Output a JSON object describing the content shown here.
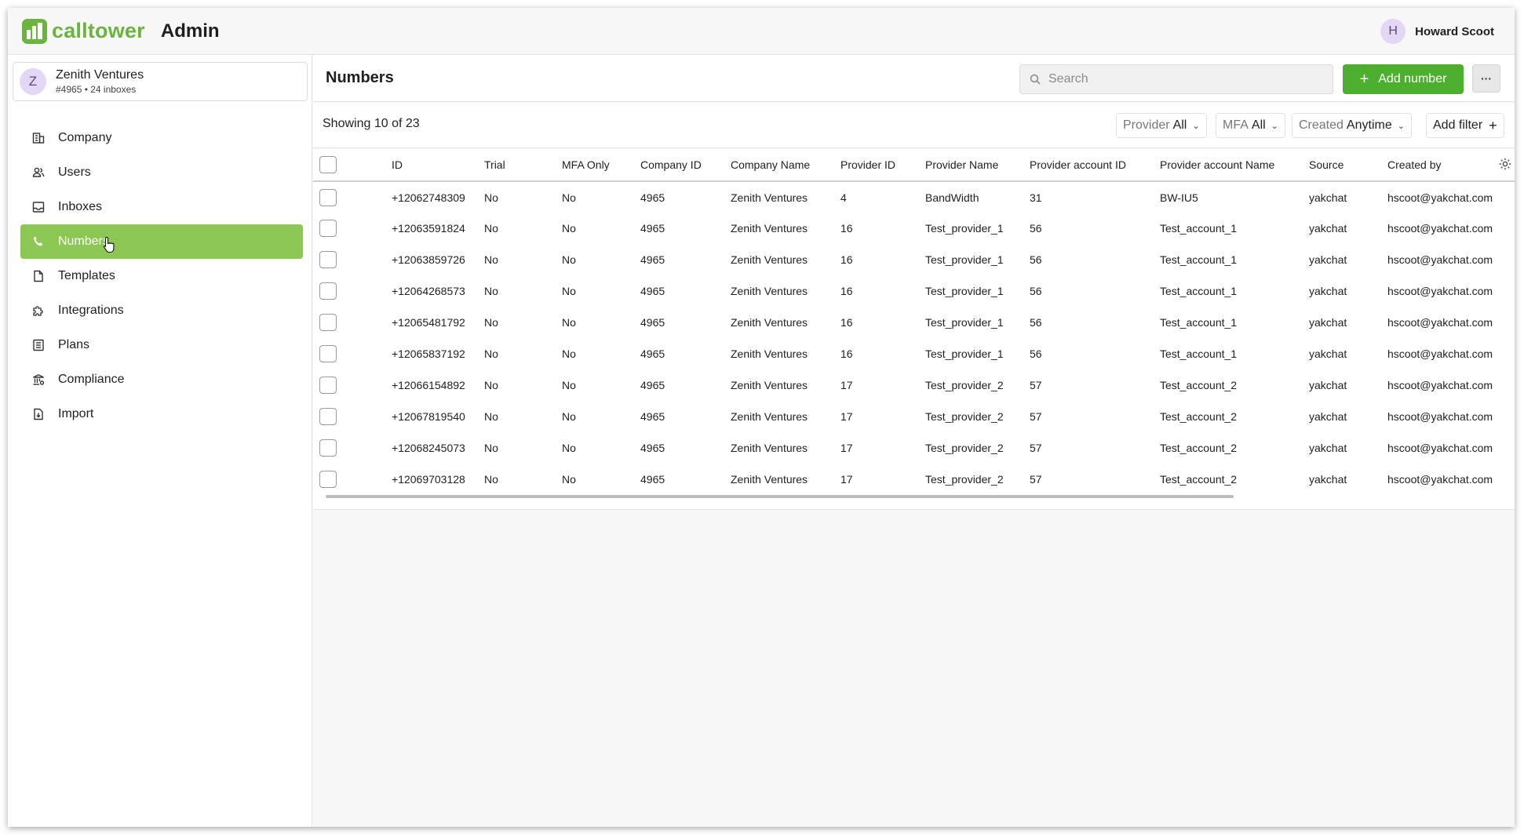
{
  "header": {
    "brand": "calltower",
    "app_title": "Admin",
    "user": {
      "initial": "H",
      "name": "Howard Scoot"
    }
  },
  "org": {
    "initial": "Z",
    "name": "Zenith Ventures",
    "subtitle": "#4965 • 24 inboxes"
  },
  "sidebar": {
    "items": [
      {
        "label": "Company",
        "icon": "building-icon"
      },
      {
        "label": "Users",
        "icon": "users-icon"
      },
      {
        "label": "Inboxes",
        "icon": "inbox-icon"
      },
      {
        "label": "Numbers",
        "icon": "phone-icon",
        "active": true
      },
      {
        "label": "Templates",
        "icon": "file-icon"
      },
      {
        "label": "Integrations",
        "icon": "puzzle-icon"
      },
      {
        "label": "Plans",
        "icon": "list-icon"
      },
      {
        "label": "Compliance",
        "icon": "bank-icon"
      },
      {
        "label": "Import",
        "icon": "file-import-icon"
      }
    ]
  },
  "main": {
    "title": "Numbers",
    "search_placeholder": "Search",
    "add_button": "Add number",
    "more_button": "···",
    "showing": "Showing 10 of 23",
    "filters": [
      {
        "label": "Provider",
        "value": "All"
      },
      {
        "label": "MFA",
        "value": "All"
      },
      {
        "label": "Created",
        "value": "Anytime"
      }
    ],
    "add_filter": "Add filter"
  },
  "table": {
    "columns": [
      "ID",
      "Trial",
      "MFA Only",
      "Company ID",
      "Company Name",
      "Provider ID",
      "Provider Name",
      "Provider account ID",
      "Provider account Name",
      "Source",
      "Created by"
    ],
    "rows": [
      [
        "+12062748309",
        "No",
        "No",
        "4965",
        "Zenith Ventures",
        "4",
        "BandWidth",
        "31",
        "BW-IU5",
        "yakchat",
        "hscoot@yakchat.com"
      ],
      [
        "+12063591824",
        "No",
        "No",
        "4965",
        "Zenith Ventures",
        "16",
        "Test_provider_1",
        "56",
        "Test_account_1",
        "yakchat",
        "hscoot@yakchat.com"
      ],
      [
        "+12063859726",
        "No",
        "No",
        "4965",
        "Zenith Ventures",
        "16",
        "Test_provider_1",
        "56",
        "Test_account_1",
        "yakchat",
        "hscoot@yakchat.com"
      ],
      [
        "+12064268573",
        "No",
        "No",
        "4965",
        "Zenith Ventures",
        "16",
        "Test_provider_1",
        "56",
        "Test_account_1",
        "yakchat",
        "hscoot@yakchat.com"
      ],
      [
        "+12065481792",
        "No",
        "No",
        "4965",
        "Zenith Ventures",
        "16",
        "Test_provider_1",
        "56",
        "Test_account_1",
        "yakchat",
        "hscoot@yakchat.com"
      ],
      [
        "+12065837192",
        "No",
        "No",
        "4965",
        "Zenith Ventures",
        "16",
        "Test_provider_1",
        "56",
        "Test_account_1",
        "yakchat",
        "hscoot@yakchat.com"
      ],
      [
        "+12066154892",
        "No",
        "No",
        "4965",
        "Zenith Ventures",
        "17",
        "Test_provider_2",
        "57",
        "Test_account_2",
        "yakchat",
        "hscoot@yakchat.com"
      ],
      [
        "+12067819540",
        "No",
        "No",
        "4965",
        "Zenith Ventures",
        "17",
        "Test_provider_2",
        "57",
        "Test_account_2",
        "yakchat",
        "hscoot@yakchat.com"
      ],
      [
        "+12068245073",
        "No",
        "No",
        "4965",
        "Zenith Ventures",
        "17",
        "Test_provider_2",
        "57",
        "Test_account_2",
        "yakchat",
        "hscoot@yakchat.com"
      ],
      [
        "+12069703128",
        "No",
        "No",
        "4965",
        "Zenith Ventures",
        "17",
        "Test_provider_2",
        "57",
        "Test_account_2",
        "yakchat",
        "hscoot@yakchat.com"
      ]
    ]
  },
  "colors": {
    "brand_green": "#6cb33f",
    "active_nav": "#8bc752",
    "primary_button": "#4caf2e"
  }
}
